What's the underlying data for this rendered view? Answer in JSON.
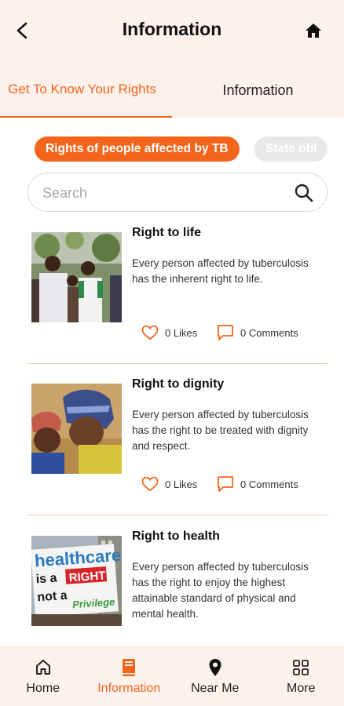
{
  "header": {
    "title": "Information",
    "back_icon": "arrow-left-icon",
    "home_icon": "home-icon"
  },
  "tabs": [
    {
      "label": "Get To Know Your Rights",
      "active": true
    },
    {
      "label": "Information",
      "active": false
    }
  ],
  "chips": [
    {
      "label": "Rights of people affected by TB",
      "active": true
    },
    {
      "label": "State obl",
      "active": false
    }
  ],
  "search": {
    "placeholder": "Search",
    "value": "",
    "icon": "search-icon"
  },
  "cards": [
    {
      "title": "Right to life",
      "description": "Every person affected by tuberculosis has the inherent right to life.",
      "likes": "0 Likes",
      "comments": "0 Comments"
    },
    {
      "title": "Right to dignity",
      "description": "Every person affected by tuberculosis has the right to be treated with dignity and respect.",
      "likes": "0 Likes",
      "comments": "0 Comments"
    },
    {
      "title": "Right to health",
      "description": "Every person affected by tuberculosis has the right to enjoy the highest attainable standard of physical and mental health.",
      "likes": "",
      "comments": ""
    }
  ],
  "poster_text": {
    "line1": "healthcare",
    "line2": "is a",
    "line3": "RIGHT",
    "line4": "not a",
    "line5": "Privilege"
  },
  "bottom_nav": [
    {
      "label": "Home",
      "icon": "home-outline-icon",
      "active": false
    },
    {
      "label": "Information",
      "icon": "book-icon",
      "active": true
    },
    {
      "label": "Near Me",
      "icon": "location-pin-icon",
      "active": false
    },
    {
      "label": "More",
      "icon": "grid-icon",
      "active": false
    }
  ],
  "colors": {
    "accent": "#f4651c",
    "header_bg": "#fdf1ec",
    "divider": "#f9c6ad",
    "chip_inactive": "#e8e8e8"
  }
}
